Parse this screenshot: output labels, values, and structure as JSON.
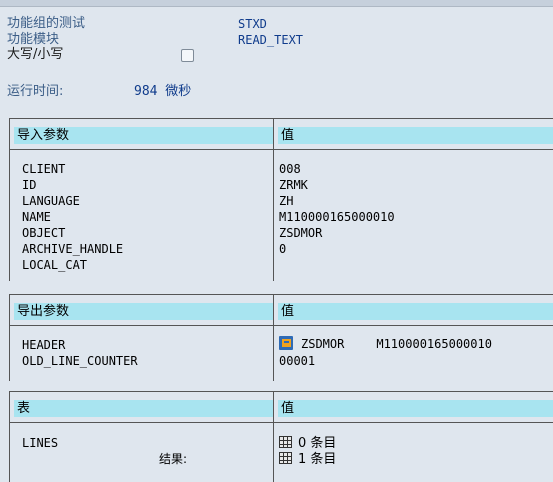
{
  "header": {
    "function_group_label": "功能组的测试",
    "function_group_value": "STXD",
    "function_module_label": "功能模块",
    "function_module_value": "READ_TEXT",
    "case_label": "大写/小写",
    "case_checked": false,
    "runtime_label": "运行时间:",
    "runtime_value": "984 微秒"
  },
  "import_section": {
    "title": "导入参数",
    "value_header": "值",
    "params": [
      {
        "name": "CLIENT",
        "value": "008"
      },
      {
        "name": "ID",
        "value": "ZRMK"
      },
      {
        "name": "LANGUAGE",
        "value": "ZH"
      },
      {
        "name": "NAME",
        "value": "M110000165000010"
      },
      {
        "name": "OBJECT",
        "value": "ZSDMOR"
      },
      {
        "name": "ARCHIVE_HANDLE",
        "value": "0"
      },
      {
        "name": "LOCAL_CAT",
        "value": ""
      }
    ]
  },
  "export_section": {
    "title": "导出参数",
    "value_header": "值",
    "header_param": "HEADER",
    "header_val_object": "ZSDMOR",
    "header_val_name": "M110000165000010",
    "header_icon": "structure-icon",
    "counter_param": "OLD_LINE_COUNTER",
    "counter_value": "00001"
  },
  "tables_section": {
    "title": "表",
    "value_header": "值",
    "lines_param": "LINES",
    "result_label": "结果:",
    "lines_before": "0 条目",
    "lines_after": "1 条目",
    "table_icon": "table-icon"
  }
}
